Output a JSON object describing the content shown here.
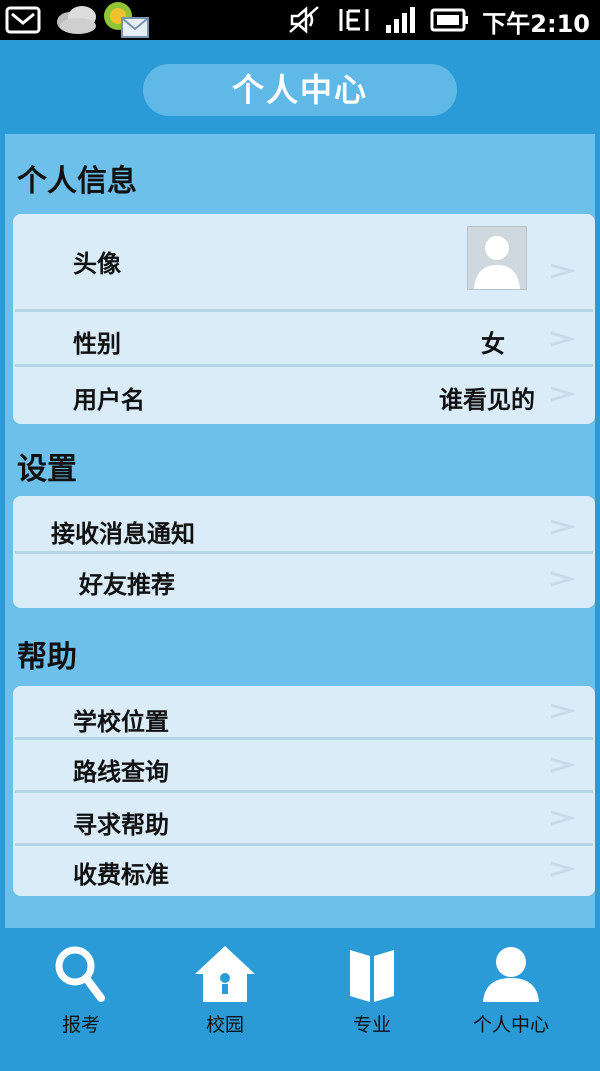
{
  "status_bar": {
    "time": "下午2:10",
    "icons": [
      "mail-icon",
      "weather-icon",
      "app-message-icon",
      "mute-icon",
      "signal-e-icon",
      "signal-bars-icon",
      "battery-icon"
    ]
  },
  "header": {
    "title": "个人中心"
  },
  "sections": {
    "personal": {
      "title": "个人信息",
      "avatar_label": "头像",
      "gender_label": "性别",
      "gender_value": "女",
      "username_label": "用户名",
      "username_value": "谁看见的"
    },
    "settings": {
      "title": "设置",
      "items": [
        "接收消息通知",
        "好友推荐"
      ]
    },
    "help": {
      "title": "帮助",
      "items": [
        "学校位置",
        "路线查询",
        "寻求帮助",
        "收费标准"
      ]
    }
  },
  "bottom_nav": {
    "items": [
      {
        "label": "报考",
        "icon": "search-icon"
      },
      {
        "label": "校园",
        "icon": "house-icon"
      },
      {
        "label": "专业",
        "icon": "book-icon"
      },
      {
        "label": "个人中心",
        "icon": "user-icon"
      }
    ],
    "active_index": 3
  },
  "colors": {
    "app_blue": "#2a9bd6",
    "panel_blue": "#6cc0ea",
    "row_bg": "#d9ecf8",
    "status_bar": "#000000"
  }
}
